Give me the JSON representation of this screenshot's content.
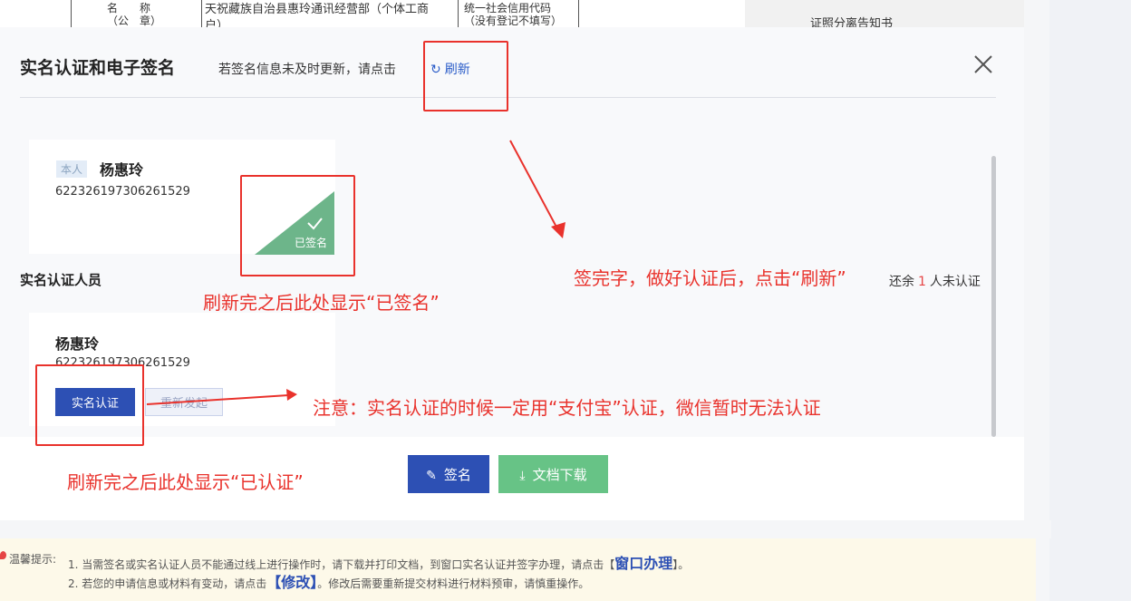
{
  "background_doc": {
    "cell1": "名　　称\n（公　章）",
    "cell2": "天祝藏族自治县惠玲通讯经营部（个体工商户）",
    "cell3": "统一社会信用代码\n（没有登记不填写）",
    "cell4": "证照分离告知书"
  },
  "modal": {
    "title": "实名认证和电子签名",
    "tip": "若签名信息未及时更新，请点击",
    "refresh_label": "刷新",
    "signer": {
      "tag": "本人",
      "name": "杨惠玲",
      "id_number": "622326197306261529",
      "badge_label": "已签名"
    },
    "section_title": "实名认证人员",
    "remaining": {
      "prefix": "还余",
      "count": "1",
      "suffix": "人未认证"
    },
    "verifier": {
      "name": "杨惠玲",
      "id_number": "622326197306261529",
      "verify_button": "实名认证",
      "restart_button": "重新发起"
    },
    "sign_button": "签名",
    "download_button": "文档下载"
  },
  "annotations": {
    "after_refresh_signed": "刷新完之后此处显示“已签名”",
    "after_sign_refresh": "签完字，做好认证后，点击“刷新”",
    "alipay_note": "注意：实名认证的时候一定用“支付宝”认证，微信暂时无法认证",
    "after_refresh_verified": "刷新完之后此处显示“已认证”"
  },
  "tips": {
    "label": "温馨提示:",
    "line1_text": "1. 当需签名或实名认证人员不能通过线上进行操作时，请下载并打印文档，到窗口实名认证并签字办理，请点击【",
    "line1_link": "窗口办理",
    "line1_end": "】。",
    "line2_text": "2. 若您的申请信息或材料有变动，请点击",
    "line2_link": "【修改】",
    "line2_end": "。修改后需要重新提交材料进行材料预审，请慎重操作。"
  },
  "colors": {
    "primary": "#2d50b4",
    "success": "#67c386",
    "signed_badge": "#6db58a",
    "annotation_red": "#e9322c"
  }
}
